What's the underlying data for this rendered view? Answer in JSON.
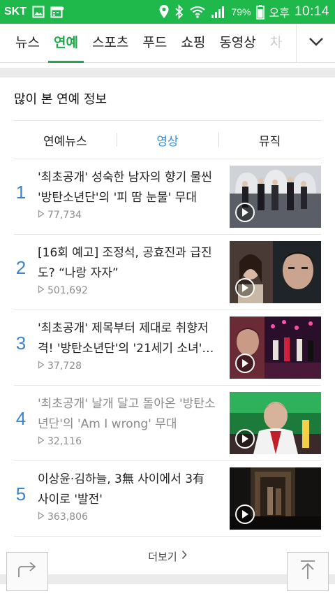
{
  "status_bar": {
    "carrier": "SKT",
    "battery_percent": "79%",
    "ampm": "오후",
    "time": "10:14",
    "icons": [
      "gallery-icon",
      "calendar-icon",
      "location-icon",
      "bluetooth-icon",
      "wifi-icon",
      "signal-icon",
      "battery-icon"
    ]
  },
  "tabs": {
    "items": [
      {
        "label": "뉴스"
      },
      {
        "label": "연예"
      },
      {
        "label": "스포츠"
      },
      {
        "label": "푸드"
      },
      {
        "label": "쇼핑"
      },
      {
        "label": "동영상"
      },
      {
        "label": "차"
      }
    ],
    "active_index": 1
  },
  "section": {
    "title": "많이 본 연예 정보",
    "subtabs": [
      {
        "label": "연예뉴스"
      },
      {
        "label": "영상"
      },
      {
        "label": "뮤직"
      }
    ],
    "active_subtab": 1
  },
  "list": [
    {
      "rank": "1",
      "title": "'최초공개' 성숙한 남자의 향기 물씬 '방탄소년단'의 '피 땀 눈물' 무대",
      "views": "77,734",
      "visited": false
    },
    {
      "rank": "2",
      "title": "[16회 예고] 조정석, 공효진과 급진도? “나랑 자자”",
      "views": "501,692",
      "visited": false
    },
    {
      "rank": "3",
      "title": "'최초공개' 제목부터 제대로 취향저격! '방탄소년단'의 '21세기 소녀'…",
      "views": "37,728",
      "visited": false
    },
    {
      "rank": "4",
      "title": "'최초공개' 날개 달고 돌아온 '방탄소년단'의 'Am I wrong' 무대",
      "views": "32,116",
      "visited": true
    },
    {
      "rank": "5",
      "title": "이상윤·김하늘, 3無 사이에서 3有 사이로 '발전'",
      "views": "363,806",
      "visited": false
    }
  ],
  "more_label": "더보기",
  "colors": {
    "status_bar": "#1fb84a",
    "active_tab": "#1ea94a",
    "active_subtab": "#3a8fd6",
    "rank": "#3a85d2"
  }
}
